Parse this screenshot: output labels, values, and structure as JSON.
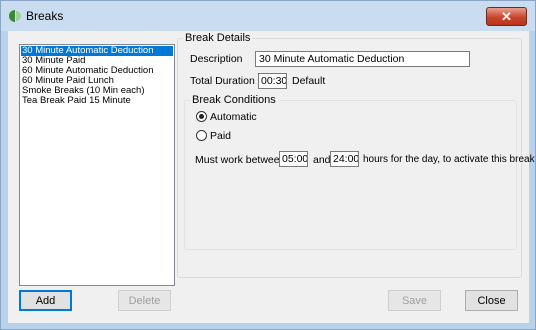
{
  "window": {
    "title": "Breaks",
    "close_glyph": "✕"
  },
  "breaks_list": {
    "items": [
      "30 Minute Automatic Deduction",
      "30 Minute Paid",
      "60 Minute Automatic Deduction",
      "60 Minute Paid Lunch",
      "Smoke Breaks (10 Min each)",
      "Tea Break Paid  15 Minute"
    ],
    "selected_index": 0
  },
  "break_details": {
    "group_label": "Break Details",
    "description_label": "Description",
    "description_value": "30 Minute Automatic Deduction",
    "total_duration_label": "Total Duration",
    "total_duration_value": "00:30",
    "default_label": "Default"
  },
  "break_conditions": {
    "group_label": "Break Conditions",
    "automatic_label": "Automatic",
    "paid_label": "Paid",
    "selected": "Automatic",
    "must_work_label": "Must work between",
    "from_value": "05:00",
    "and_label": "and",
    "to_value": "24:00",
    "suffix_label": "hours for the day, to activate this break"
  },
  "buttons": {
    "add": "Add",
    "delete": "Delete",
    "save": "Save",
    "close": "Close"
  },
  "colors": {
    "selection": "#0078d7",
    "title_close": "#c8452c",
    "app_icon_green": "#3a8a3a"
  }
}
